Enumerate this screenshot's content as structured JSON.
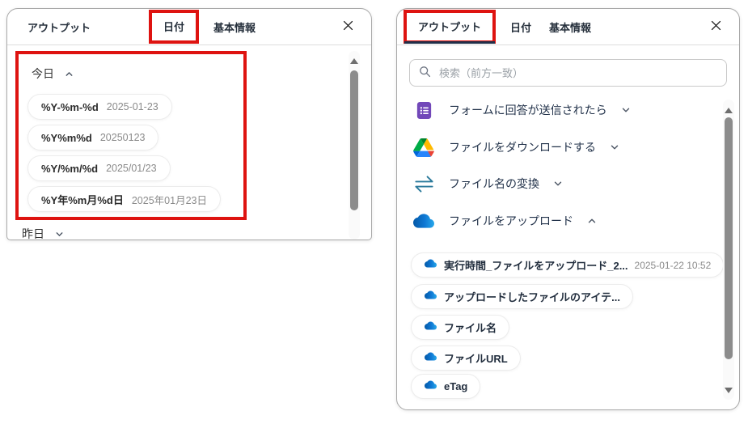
{
  "colors": {
    "annotation_red": "#de1310",
    "tab_text_dark": "#26303c",
    "active_underline": "#20304a",
    "muted_value_gray": "#8a8a8a",
    "forms_purple": "#7248b9",
    "drive_green": "#00ac47",
    "drive_yellow": "#ffba00",
    "drive_blue": "#2684fc",
    "onedrive_blue": "#0f78d4",
    "transfer_teal": "#2b7a9b"
  },
  "left_panel": {
    "tabs": [
      {
        "label": "アウトプット",
        "active": false,
        "annotated": false
      },
      {
        "label": "日付",
        "active": true,
        "annotated": true
      },
      {
        "label": "基本情報",
        "active": false,
        "annotated": false
      }
    ],
    "sections": [
      {
        "label": "今日",
        "state": "expanded",
        "pills": [
          {
            "format": "%Y-%m-%d",
            "value": "2025-01-23"
          },
          {
            "format": "%Y%m%d",
            "value": "20250123"
          },
          {
            "format": "%Y/%m/%d",
            "value": "2025/01/23"
          },
          {
            "format": "%Y年%m月%d日",
            "value": "2025年01月23日"
          }
        ]
      },
      {
        "label": "昨日",
        "state": "collapsed",
        "pills": []
      }
    ]
  },
  "right_panel": {
    "tabs": [
      {
        "label": "アウトプット",
        "active": true,
        "annotated": true
      },
      {
        "label": "日付",
        "active": false,
        "annotated": false
      },
      {
        "label": "基本情報",
        "active": false,
        "annotated": false
      }
    ],
    "search": {
      "placeholder": "検索（前方一致）",
      "value": ""
    },
    "items": [
      {
        "icon": "google-forms-icon",
        "label": "フォームに回答が送信されたら",
        "state": "collapsed"
      },
      {
        "icon": "google-drive-icon",
        "label": "ファイルをダウンロードする",
        "state": "collapsed"
      },
      {
        "icon": "transfer-arrows-icon",
        "label": "ファイル名の変換",
        "state": "collapsed"
      },
      {
        "icon": "onedrive-icon",
        "label": "ファイルをアップロード",
        "state": "expanded"
      }
    ],
    "output_pills": [
      {
        "label": "実行時間_ファイルをアップロード_2...",
        "value": "2025-01-22 10:52"
      },
      {
        "label": "アップロードしたファイルのアイテ...",
        "value": ""
      },
      {
        "label": "ファイル名",
        "value": ""
      },
      {
        "label": "ファイルURL",
        "value": ""
      },
      {
        "label": "eTag",
        "value": ""
      }
    ]
  }
}
